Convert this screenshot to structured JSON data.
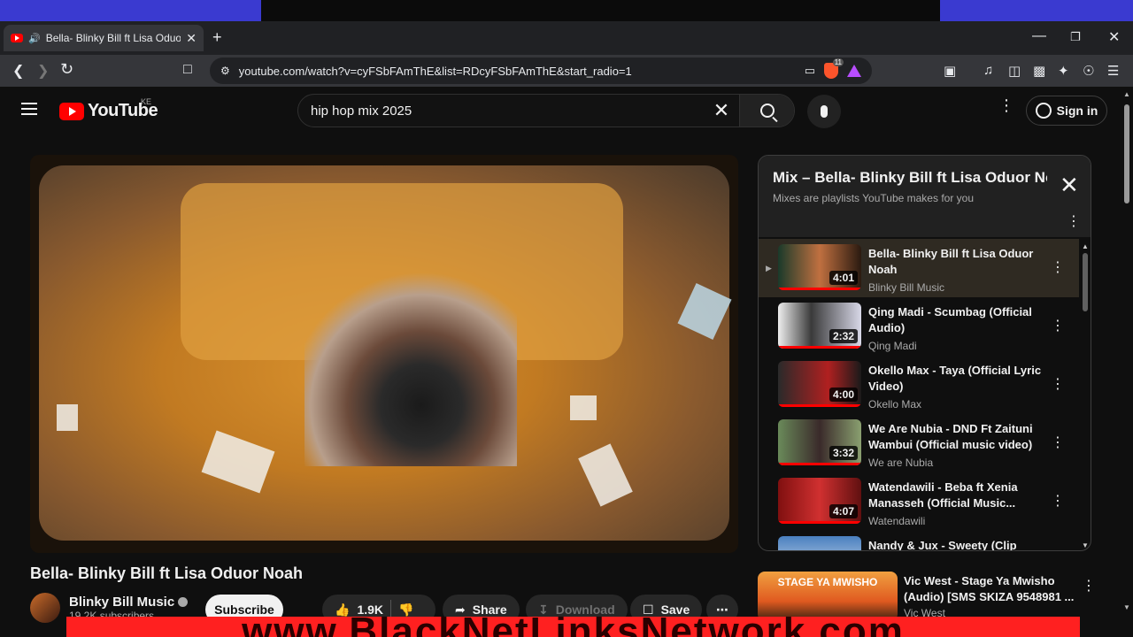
{
  "browser": {
    "tab_title": "Bella- Blinky Bill ft Lisa Oduor",
    "url": "youtube.com/watch?v=cyFSbFAmThE&list=RDcyFSbFAmThE&start_radio=1",
    "shield_count": "11"
  },
  "header": {
    "logo_text": "YouTube",
    "country_code": "KE",
    "search_value": "hip hop mix 2025",
    "signin_label": "Sign in"
  },
  "video": {
    "title": "Bella- Blinky Bill ft Lisa Oduor Noah",
    "channel": "Blinky Bill Music",
    "subscribers": "19.2K subscribers",
    "subscribe_label": "Subscribe",
    "likes": "1.9K",
    "share_label": "Share",
    "download_label": "Download",
    "save_label": "Save"
  },
  "playlist": {
    "title": "Mix – Bella- Blinky Bill ft Lisa Oduor Noah",
    "subtitle": "Mixes are playlists YouTube makes for you",
    "items": [
      {
        "title": "Bella- Blinky Bill ft Lisa Oduor Noah",
        "channel": "Blinky Bill Music",
        "duration": "4:01"
      },
      {
        "title": "Qing Madi - Scumbag (Official Audio)",
        "channel": "Qing Madi",
        "duration": "2:32"
      },
      {
        "title": "Okello Max - Taya (Official Lyric Video)",
        "channel": "Okello Max",
        "duration": "4:00"
      },
      {
        "title": "We Are Nubia - DND Ft Zaituni Wambui (Official music video)",
        "channel": "We are Nubia",
        "duration": "3:32"
      },
      {
        "title": "Watendawili - Beba ft Xenia Manasseh (Official Music...",
        "channel": "Watendawili",
        "duration": "4:07"
      },
      {
        "title": "Nandy & Jux - Sweety (Clip",
        "channel": "",
        "duration": ""
      }
    ]
  },
  "recommended": {
    "title": "Vic West - Stage Ya Mwisho (Audio) [SMS SKIZA 9548981 ...",
    "channel": "Vic West",
    "thumb_text": "STAGE YA MWISHO"
  },
  "watermark": {
    "text": "www.BlackNetLinksNetwork.com"
  },
  "colors": {
    "accent": "#ff0000",
    "background": "#0f0f0f",
    "active_row": "#2f2a22"
  }
}
